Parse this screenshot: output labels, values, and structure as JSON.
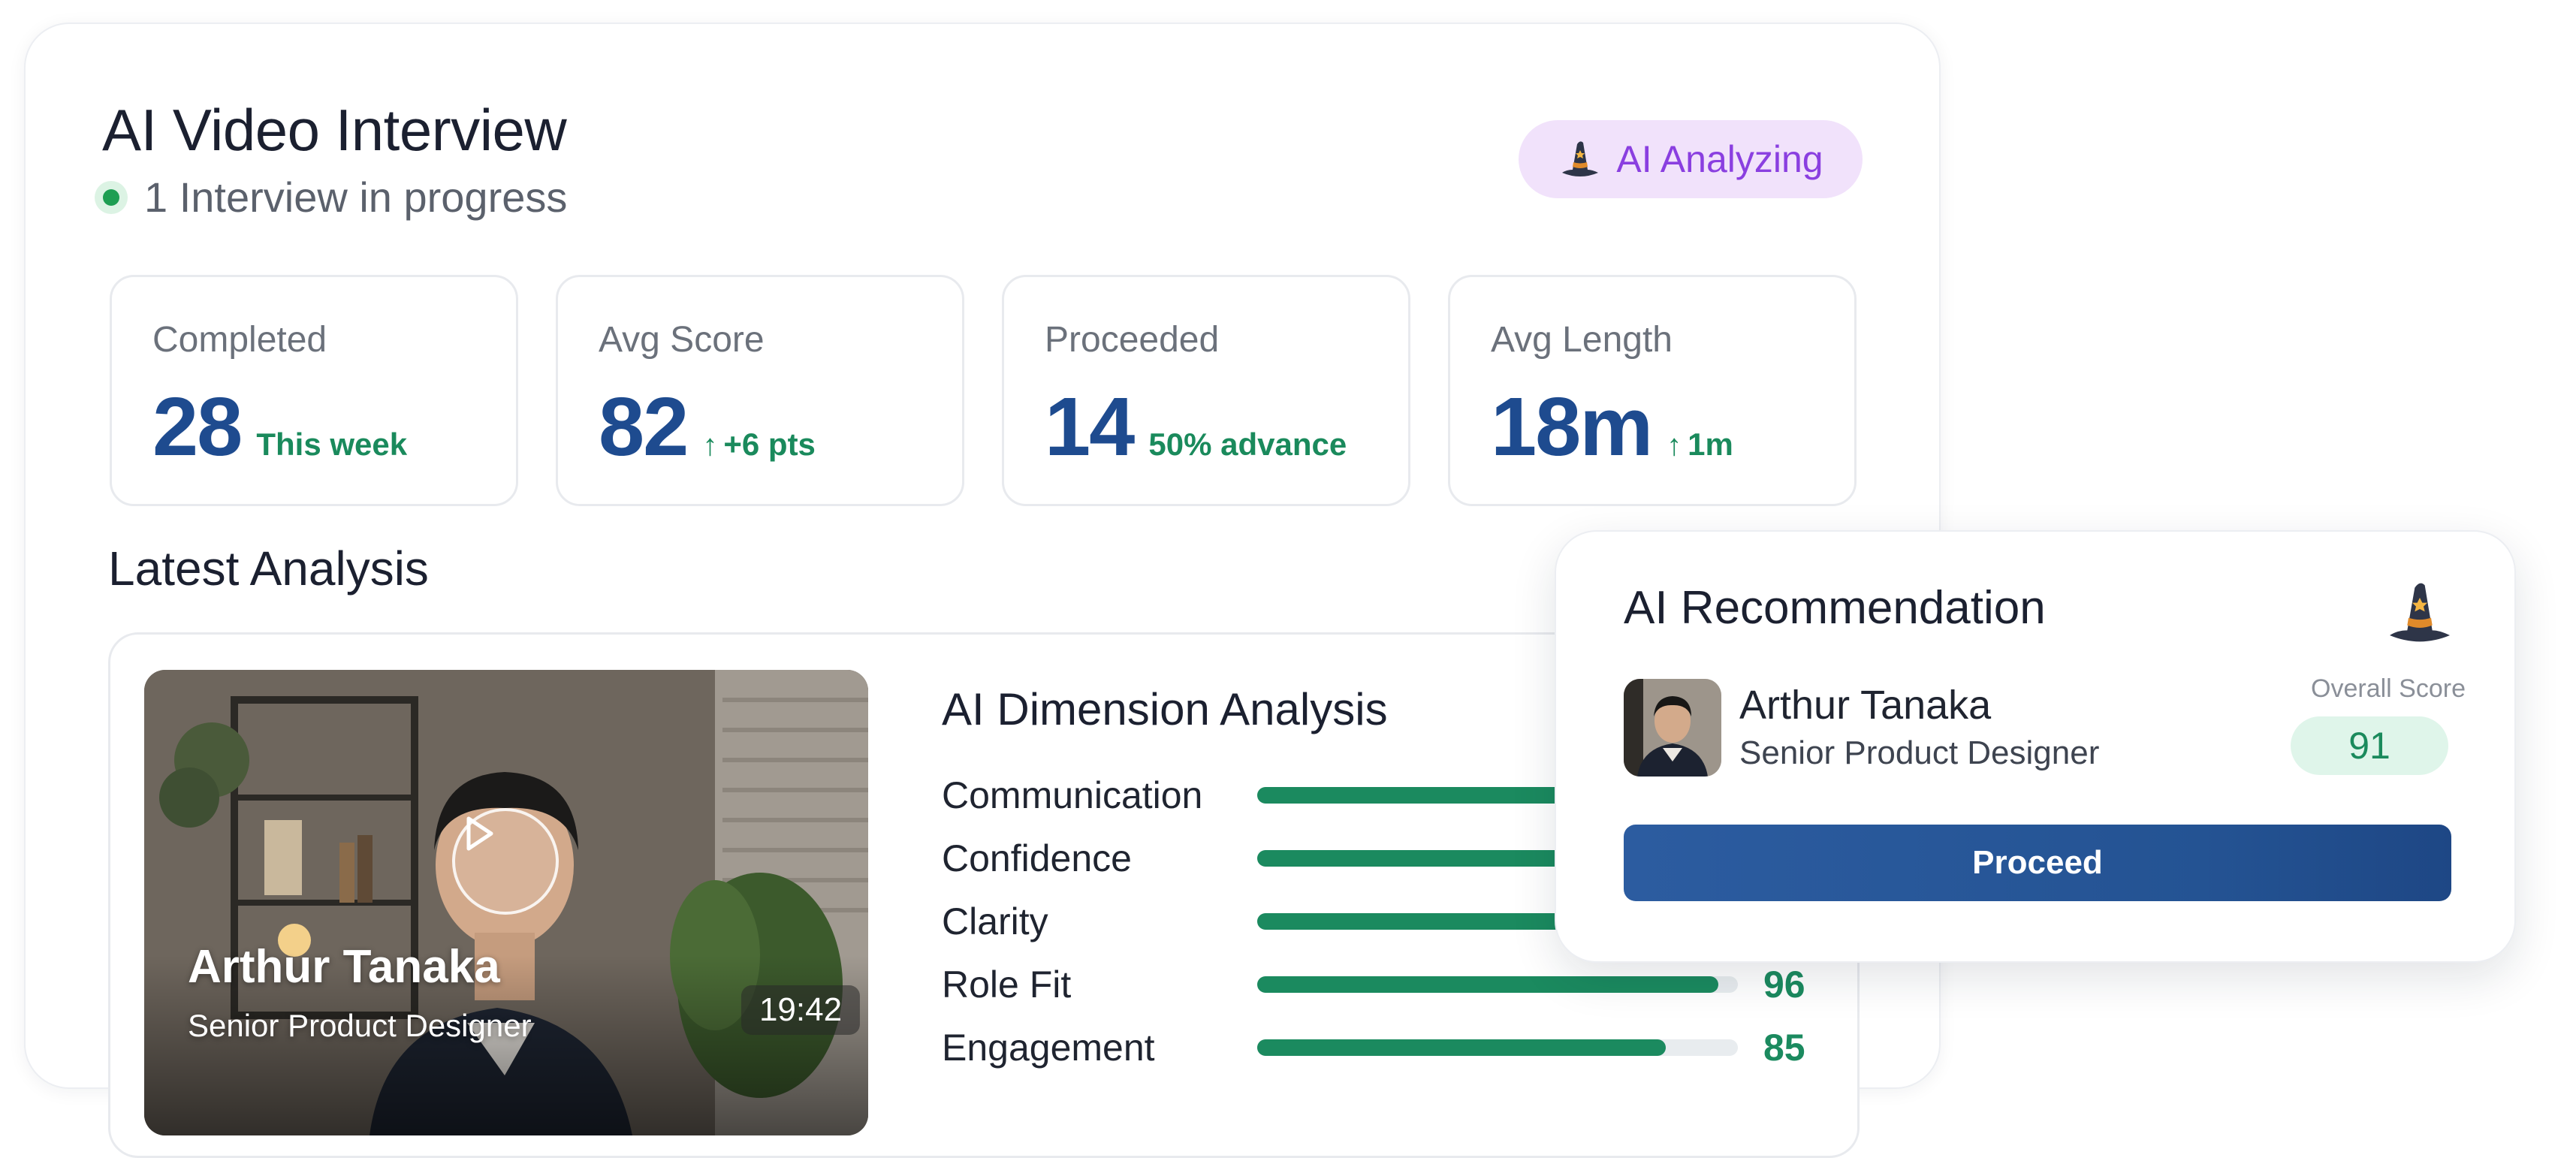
{
  "header": {
    "title": "AI Video Interview",
    "status": "1 Interview in progress",
    "badge": "AI Analyzing"
  },
  "stats": [
    {
      "label": "Completed",
      "value": "28",
      "sub": "This week",
      "arrow": ""
    },
    {
      "label": "Avg Score",
      "value": "82",
      "sub": "+6 pts",
      "arrow": "↑"
    },
    {
      "label": "Proceeded",
      "value": "14",
      "sub": "50% advance",
      "arrow": ""
    },
    {
      "label": "Avg Length",
      "value": "18m",
      "sub": "1m",
      "arrow": "↑"
    }
  ],
  "latest": {
    "title": "Latest Analysis",
    "video": {
      "name": "Arthur Tanaka",
      "role": "Senior Product Designer",
      "duration": "19:42"
    },
    "dimensions": {
      "title": "AI Dimension Analysis",
      "items": [
        {
          "label": "Communication",
          "score": "",
          "fill": 0.9
        },
        {
          "label": "Confidence",
          "score": "",
          "fill": 0.88
        },
        {
          "label": "Clarity",
          "score": "",
          "fill": 0.9
        },
        {
          "label": "Role Fit",
          "score": "96",
          "fill": 0.96
        },
        {
          "label": "Engagement",
          "score": "85",
          "fill": 0.85
        }
      ]
    }
  },
  "recommendation": {
    "title": "AI Recommendation",
    "candidate_name": "Arthur Tanaka",
    "candidate_role": "Senior Product Designer",
    "score_label": "Overall Score",
    "score": "91",
    "button": "Proceed"
  },
  "icons": {
    "hat": "wizard-hat-icon",
    "play": "play-icon",
    "status": "status-dot-icon"
  },
  "colors": {
    "accent_blue": "#1e4b8f",
    "accent_green": "#1a8a5c",
    "accent_purple": "#8a3fe0",
    "button_blue": "#2c5ca0"
  }
}
